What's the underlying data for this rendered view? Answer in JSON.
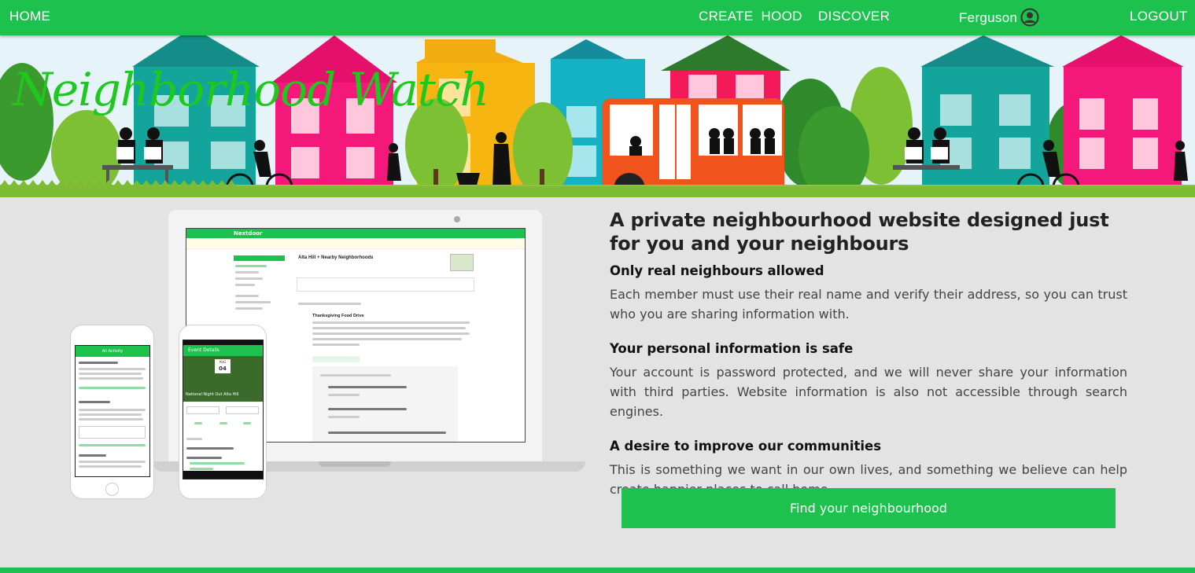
{
  "nav": {
    "home": "HOME",
    "create": "CREATE",
    "hood": "HOOD",
    "discover": "DISCOVER",
    "username": "Ferguson",
    "logout": "LOGOUT"
  },
  "banner": {
    "brand": "Neighborhood Watch"
  },
  "hero": {
    "headline": "A private neighbourhood website designed just for you and your neighbours",
    "features": [
      {
        "title": "Only real neighbours allowed",
        "text": "Each member must use their real name and verify their address, so you can trust who you are sharing information with."
      },
      {
        "title": "Your personal information is safe",
        "text": "Your account is password protected, and we will never share your information with third parties. Website information is also not accessible through search engines."
      },
      {
        "title": "A desire to improve our communities",
        "text": "This is something we want in our own lives, and something we believe can help create happier places to call home."
      }
    ],
    "cta": "Find your neighbourhood"
  },
  "mockup": {
    "laptop_brand": "Nextdoor",
    "laptop_heading": "Alta Hill + Nearby Neighborhoods",
    "post_title": "Thanksgiving Food Drive",
    "phone_heading": "Event Details",
    "phone_date_month": "AUG",
    "phone_date_day": "04",
    "phone_event": "National Night Out Alta Hill",
    "phone2_tab": "All Activity"
  },
  "colors": {
    "accent": "#1cc24d",
    "background": "#e3e3e3"
  }
}
